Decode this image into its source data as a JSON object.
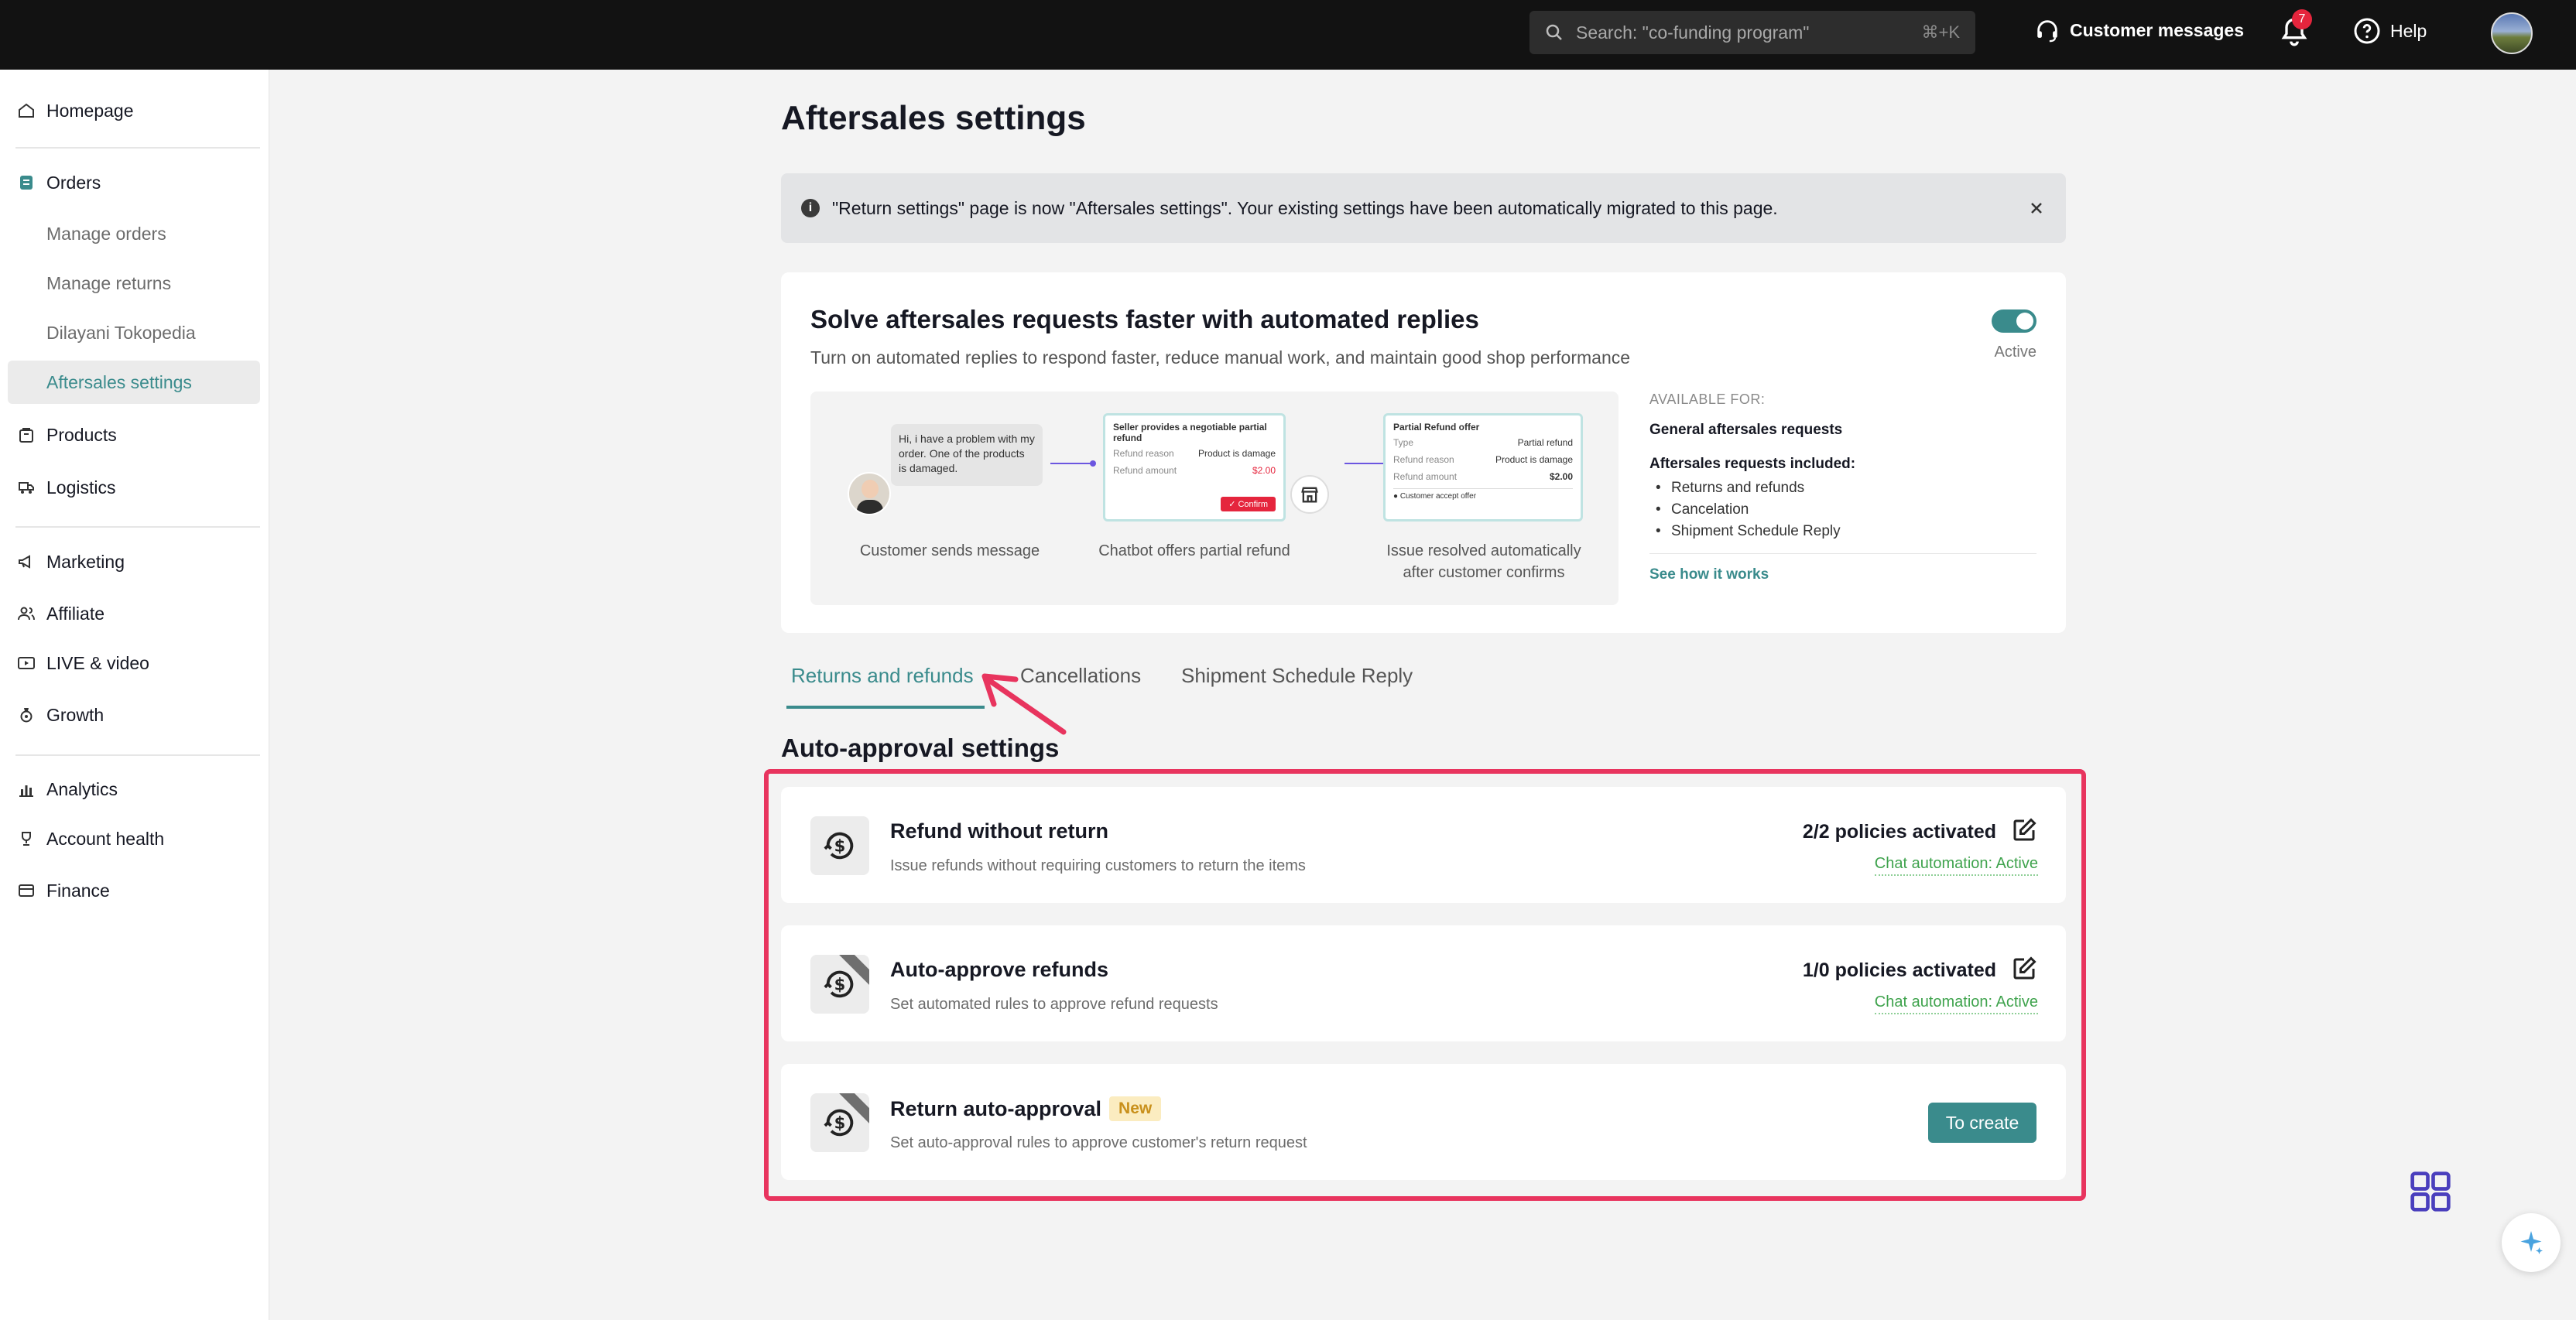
{
  "topbar": {
    "search_placeholder": "Search: \"co-funding program\"",
    "search_shortcut": "⌘+K",
    "customer_messages": "Customer messages",
    "notification_count": "7",
    "help": "Help"
  },
  "sidebar": {
    "homepage": "Homepage",
    "orders": "Orders",
    "orders_sub": [
      "Manage orders",
      "Manage returns",
      "Dilayani Tokopedia",
      "Aftersales settings"
    ],
    "products": "Products",
    "logistics": "Logistics",
    "marketing": "Marketing",
    "affiliate": "Affiliate",
    "live_video": "LIVE & video",
    "growth": "Growth",
    "analytics": "Analytics",
    "account_health": "Account health",
    "finance": "Finance"
  },
  "page": {
    "title": "Aftersales settings",
    "banner": "\"Return settings\" page is now \"Aftersales settings\". Your existing settings have been automatically migrated to this page."
  },
  "automation": {
    "title": "Solve aftersales requests faster with automated replies",
    "subtitle": "Turn on automated replies to respond faster, reduce manual work, and maintain good shop performance",
    "toggle_label": "Active",
    "chat_message": "Hi, i have a problem with my order. One of the products is damaged.",
    "offer_card": {
      "title": "Seller provides a negotiable partial refund",
      "reason_label": "Refund reason",
      "reason_value": "Product is damage",
      "amount_label": "Refund amount",
      "amount_value": "$2.00",
      "confirm": "Confirm"
    },
    "resolved_card": {
      "title": "Partial Refund offer",
      "type_label": "Type",
      "type_value": "Partial refund",
      "reason_label": "Refund reason",
      "reason_value": "Product is damage",
      "amount_label": "Refund amount",
      "amount_value": "$2.00",
      "footer": "Customer accept offer"
    },
    "captions": [
      "Customer sends message",
      "Chatbot offers partial refund",
      "Issue resolved automatically",
      "after customer confirms"
    ],
    "available_for_label": "AVAILABLE FOR:",
    "available_general": "General aftersales requests",
    "included_label": "Aftersales requests included:",
    "included_items": [
      "Returns and refunds",
      "Cancelation",
      "Shipment Schedule Reply"
    ],
    "see_how": "See how it works"
  },
  "tabs": [
    "Returns and refunds",
    "Cancellations",
    "Shipment Schedule Reply"
  ],
  "section_title": "Auto-approval settings",
  "policies": [
    {
      "title": "Refund without return",
      "desc": "Issue refunds without requiring customers to return the items",
      "status": "2/2 policies activated",
      "chat": "Chat automation: Active"
    },
    {
      "title": "Auto-approve refunds",
      "desc": "Set automated rules to approve refund requests",
      "status": "1/0 policies activated",
      "chat": "Chat automation: Active"
    },
    {
      "title": "Return auto-approval",
      "badge": "New",
      "desc": "Set auto-approval rules to approve customer's return request",
      "button": "To create"
    }
  ],
  "colors": {
    "accent": "#3a8b8c",
    "highlight": "#e8345e",
    "chat_active": "#3fa34d",
    "new_badge": "#c9901b"
  }
}
